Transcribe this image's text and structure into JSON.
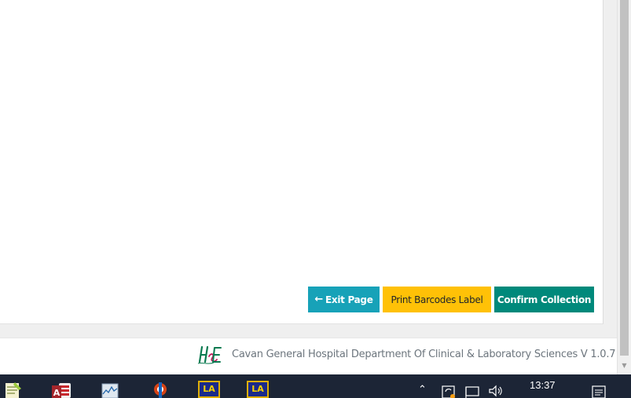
{
  "actions": {
    "exit_label": "Exit Page",
    "print_label": "Print Barcodes Label",
    "confirm_label": "Confirm Collection"
  },
  "footer": {
    "logo_text": "HSE",
    "text": "Cavan General Hospital Department Of Clinical & Laboratory Sciences V 1.0.7"
  },
  "taskbar": {
    "apps": [
      "notepad-plus-plus",
      "microsoft-access",
      "performance-monitor",
      "app-tool",
      "la-app",
      "la-app"
    ],
    "app_badge": "LA",
    "clock": "13:37"
  },
  "colors": {
    "exit": "#17a2b8",
    "print": "#ffc107",
    "confirm": "#00897b",
    "taskbar": "#1c2536"
  }
}
